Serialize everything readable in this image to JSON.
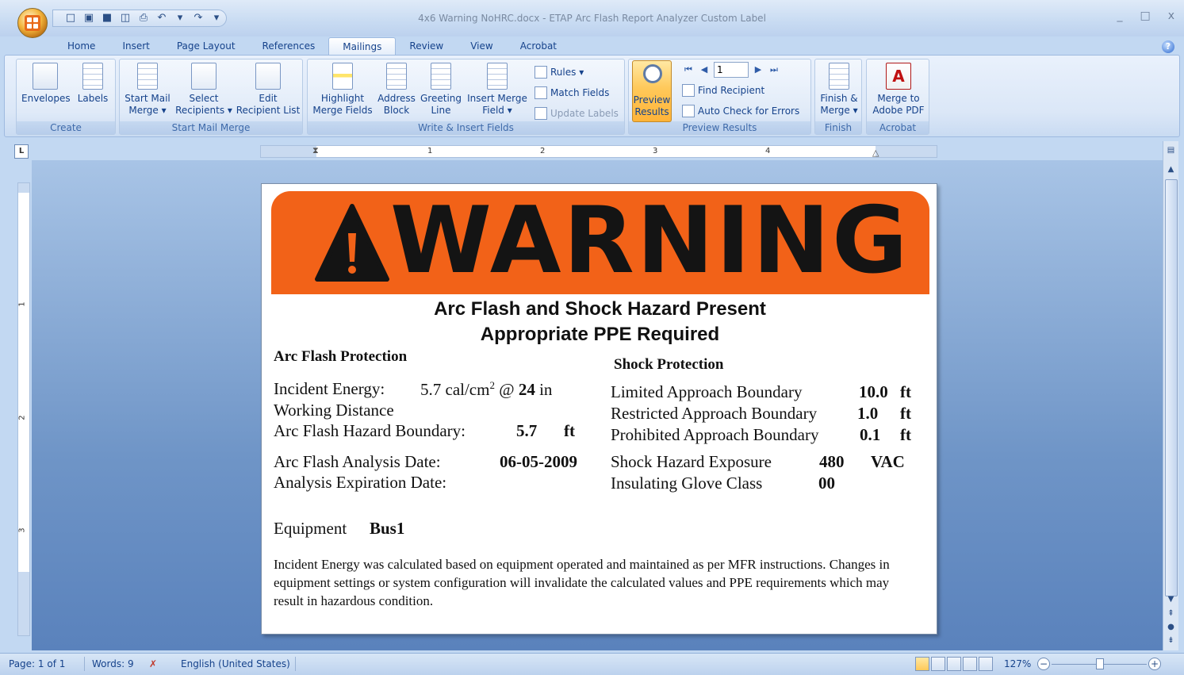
{
  "window": {
    "title": "4x6 Warning NoHRC.docx - ETAP Arc Flash Report Analyzer Custom Label",
    "minimize": "_",
    "maximize": "□",
    "close": "x"
  },
  "tabs": [
    "Home",
    "Insert",
    "Page Layout",
    "References",
    "Mailings",
    "Review",
    "View",
    "Acrobat"
  ],
  "ribbon": {
    "create": {
      "label": "Create",
      "envelopes": "Envelopes",
      "labels": "Labels"
    },
    "start": {
      "label": "Start Mail Merge",
      "start_mail_merge_1": "Start Mail",
      "start_mail_merge_2": "Merge ▾",
      "select_recipients_1": "Select",
      "select_recipients_2": "Recipients ▾",
      "edit_list_1": "Edit",
      "edit_list_2": "Recipient List"
    },
    "write": {
      "label": "Write & Insert Fields",
      "highlight_1": "Highlight",
      "highlight_2": "Merge Fields",
      "address_1": "Address",
      "address_2": "Block",
      "greeting_1": "Greeting",
      "greeting_2": "Line",
      "insert_1": "Insert Merge",
      "insert_2": "Field ▾",
      "rules": "Rules ▾",
      "match_fields": "Match Fields",
      "update_labels": "Update Labels"
    },
    "preview": {
      "label": "Preview Results",
      "preview_1": "Preview",
      "preview_2": "Results",
      "record": "1",
      "find_recipient": "Find Recipient",
      "auto_check": "Auto Check for Errors"
    },
    "finish": {
      "label": "Finish",
      "finish_1": "Finish &",
      "finish_2": "Merge ▾"
    },
    "acrobat": {
      "label": "Acrobat",
      "merge_pdf_1": "Merge to",
      "merge_pdf_2": "Adobe PDF"
    }
  },
  "ruler": {
    "tab_selector": "L",
    "h_numbers": [
      "1",
      "2",
      "3",
      "4"
    ],
    "v_numbers": [
      "1",
      "2",
      "3"
    ]
  },
  "label": {
    "warning": "WARNING",
    "hazard_line1": "Arc Flash and Shock Hazard Present",
    "hazard_line2": "Appropriate PPE Required",
    "arc_heading": "Arc Flash  Protection",
    "shock_heading": "Shock Protection",
    "incident_energy_label": "Incident Energy:",
    "incident_energy_value": "5.7 cal/cm",
    "incident_energy_sup": "2",
    "at_sign": "@",
    "working_distance_value": "24",
    "working_distance_unit": "in",
    "working_distance_label": "Working Distance",
    "afb_label": "Arc Flash Hazard Boundary:",
    "afb_value": "5.7",
    "afb_unit": "ft",
    "analysis_date_label": "Arc Flash Analysis Date:",
    "analysis_date_value": "06-05-2009",
    "expiration_label": "Analysis Expiration Date:",
    "lab_label": "Limited Approach  Boundary",
    "lab_value": "10.0",
    "lab_unit": "ft",
    "rab_label": "Restricted Approach Boundary",
    "rab_value": "1.0",
    "rab_unit": "ft",
    "pab_label": "Prohibited Approach Boundary",
    "pab_value": "0.1",
    "pab_unit": "ft",
    "she_label": "Shock Hazard Exposure",
    "she_value": "480",
    "she_unit": "VAC",
    "glove_label": "Insulating Glove Class",
    "glove_value": "00",
    "equipment_label": "Equipment",
    "equipment_value": "Bus1",
    "disclaimer": "Incident Energy was calculated based on equipment operated and maintained as per MFR instructions. Changes in equipment settings or system configuration will invalidate the calculated values and PPE requirements which may result in hazardous condition."
  },
  "status": {
    "page": "Page: 1 of 1",
    "words": "Words: 9",
    "language": "English (United States)",
    "zoom": "127%"
  },
  "colors": {
    "warning_orange": "#f26218",
    "ribbon_blue": "#dbe7f7"
  }
}
